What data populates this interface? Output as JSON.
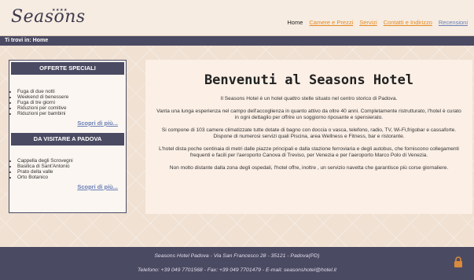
{
  "header": {
    "logo": "Seasons",
    "stars": "★★★★",
    "nav": {
      "home": "Home",
      "rooms": "Camere e Prezzi",
      "services": "Servizi",
      "contacts": "Contatti e Indirizzo",
      "reviews": "Recensioni"
    }
  },
  "breadcrumb": "Ti trovi in: Home",
  "sidebar": {
    "offers": {
      "title": "OFFERTE SPECIALI",
      "items": [
        "Fuga di due notti",
        "Weekend di benessere",
        "Fuga di tre giorni",
        "Riduzioni per comitive",
        "Riduzioni per bambini"
      ],
      "link": "Scopri di più..."
    },
    "visit": {
      "title": "DA VISITARE A PADOVA",
      "items": [
        "Cappella degli Scrovegni",
        "Basilica di Sant'Antonio",
        "Prato della valle",
        "Orto Botanico"
      ],
      "link": "Scopri di più..."
    }
  },
  "main": {
    "title": "Benvenuti al Seasons Hotel",
    "paragraphs": [
      "Il Seasons Hotel è un hotel quattro stelle situato nel centro storico di Padova.",
      "Vanta una lunga esperienza nel campo dell'accoglienza in quanto attivo da oltre 40 anni. Completamente ristrutturato, l'hotel è curato in ogni dettaglio per offrire un soggiorno riposante e spensierato.",
      "Si compone di 103 camere climatizzate tutte dotate di bagno con doccia o vasca, telefono, radio, TV, Wi-Fi,frigobar e cassaforte. Dispone di numerosi servizi quali Piscina, area Wellness e Fitness, bar e ristorante.",
      "L'hotel dista poche centinaia di metri dalle piazze principali e dalla stazione ferroviaria e degli autobus, che forniscono collegamenti frequenti e facili per l'aeroporto Canova di Treviso, per Venezia e per l'aeroporto Marco Polo di Venezia.",
      "Non molto distante dalla zona degli ospedali, l'hotel offre, inoltre , un servizio navetta che garantisce più corse giornaliere."
    ]
  },
  "footer": {
    "address": "Seasons Hotel Padova - Via San Francesco 28 - 35121 - Padova(PD)",
    "contacts": "Telefono: +39 049 7701568 - Fax: +39 049 7701479 - E-mail: seasonshotel@hotel.it",
    "lock_icon_color": "#d98a3a"
  }
}
